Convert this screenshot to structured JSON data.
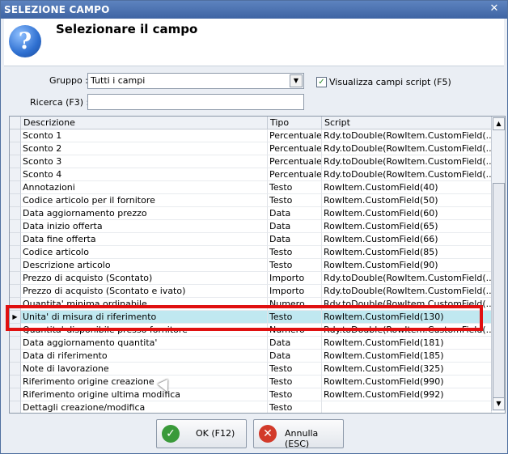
{
  "window": {
    "title": "SELEZIONE CAMPO",
    "close_glyph": "✕"
  },
  "header": {
    "heading": "Selezionare il campo",
    "help_icon": "?"
  },
  "filters": {
    "group_label": "Gruppo :",
    "group_value": "Tutti i campi",
    "search_label": "Ricerca (F3) :",
    "search_value": "",
    "script_checkbox_label": "Visualizza campi script (F5)",
    "script_checkbox_checked": true
  },
  "grid": {
    "columns": [
      "Descrizione",
      "Tipo",
      "Script"
    ],
    "rows": [
      {
        "desc": "Sconto 1",
        "tipo": "Percentuale",
        "script": "Rdy.toDouble(RowItem.CustomField(..."
      },
      {
        "desc": "Sconto 2",
        "tipo": "Percentuale",
        "script": "Rdy.toDouble(RowItem.CustomField(..."
      },
      {
        "desc": "Sconto 3",
        "tipo": "Percentuale",
        "script": "Rdy.toDouble(RowItem.CustomField(..."
      },
      {
        "desc": "Sconto 4",
        "tipo": "Percentuale",
        "script": "Rdy.toDouble(RowItem.CustomField(..."
      },
      {
        "desc": "Annotazioni",
        "tipo": "Testo",
        "script": "RowItem.CustomField(40)"
      },
      {
        "desc": "Codice articolo per il fornitore",
        "tipo": "Testo",
        "script": "RowItem.CustomField(50)"
      },
      {
        "desc": "Data aggiornamento prezzo",
        "tipo": "Data",
        "script": "RowItem.CustomField(60)"
      },
      {
        "desc": "Data inizio offerta",
        "tipo": "Data",
        "script": "RowItem.CustomField(65)"
      },
      {
        "desc": "Data fine offerta",
        "tipo": "Data",
        "script": "RowItem.CustomField(66)"
      },
      {
        "desc": "Codice articolo",
        "tipo": "Testo",
        "script": "RowItem.CustomField(85)"
      },
      {
        "desc": "Descrizione articolo",
        "tipo": "Testo",
        "script": "RowItem.CustomField(90)"
      },
      {
        "desc": "Prezzo di acquisto (Scontato)",
        "tipo": "Importo",
        "script": "Rdy.toDouble(RowItem.CustomField(..."
      },
      {
        "desc": "Prezzo di acquisto (Scontato e ivato)",
        "tipo": "Importo",
        "script": "Rdy.toDouble(RowItem.CustomField(..."
      },
      {
        "desc": "Quantita' minima ordinabile",
        "tipo": "Numero",
        "script": "Rdy.toDouble(RowItem.CustomField(..."
      },
      {
        "desc": "Unita' di misura di riferimento",
        "tipo": "Testo",
        "script": "RowItem.CustomField(130)",
        "selected": true
      },
      {
        "desc": "Quantita' disponibile presso fornitore",
        "tipo": "Numero",
        "script": "Rdy.toDouble(RowItem.CustomField(..."
      },
      {
        "desc": "Data aggiornamento quantita'",
        "tipo": "Data",
        "script": "RowItem.CustomField(181)"
      },
      {
        "desc": "Data di riferimento",
        "tipo": "Data",
        "script": "RowItem.CustomField(185)"
      },
      {
        "desc": "Note di lavorazione",
        "tipo": "Testo",
        "script": "RowItem.CustomField(325)"
      },
      {
        "desc": "Riferimento origine creazione",
        "tipo": "Testo",
        "script": "RowItem.CustomField(990)"
      },
      {
        "desc": "Riferimento origine ultima modifica",
        "tipo": "Testo",
        "script": "RowItem.CustomField(992)"
      },
      {
        "desc": "Dettagli creazione/modifica",
        "tipo": "Testo",
        "script": ""
      }
    ]
  },
  "buttons": {
    "ok_label": "OK (F12)",
    "cancel_label": "Annulla (ESC)"
  },
  "colors": {
    "selection": "#c0e8f0",
    "highlight_border": "#e01010",
    "ok_icon": "#3a9a3a",
    "cancel_icon": "#d23a2a"
  }
}
